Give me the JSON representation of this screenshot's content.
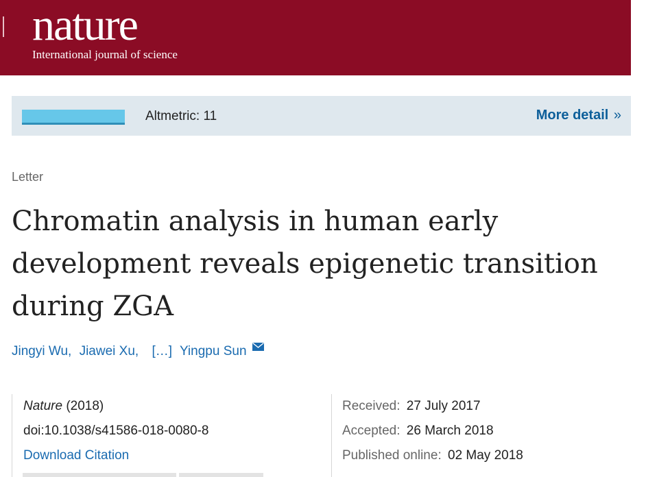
{
  "header": {
    "logo": "nature",
    "tagline": "International journal of science"
  },
  "altmetric": {
    "label": "Altmetric: 11",
    "more": "More detail",
    "more_icon": "double-chevron-right-icon"
  },
  "article": {
    "type": "Letter",
    "title": "Chromatin analysis in human early development reveals epigenetic transition during ZGA",
    "authors": [
      "Jingyi Wu,",
      "Jiawei Xu,",
      "[…]",
      "Yingpu Sun"
    ],
    "author_icon": "mail-icon"
  },
  "meta": {
    "journal": "Nature",
    "year": "(2018)",
    "doi": "doi:10.1038/s41586-018-0080-8",
    "download": "Download Citation",
    "received_label": "Received:",
    "received": "27 July 2017",
    "accepted_label": "Accepted:",
    "accepted": "26 March 2018",
    "published_label": "Published online:",
    "published": "02 May 2018"
  },
  "colors": {
    "brand": "#8b0c25",
    "link": "#1a6bb0",
    "altmetric_bg": "#dfe8ee"
  }
}
